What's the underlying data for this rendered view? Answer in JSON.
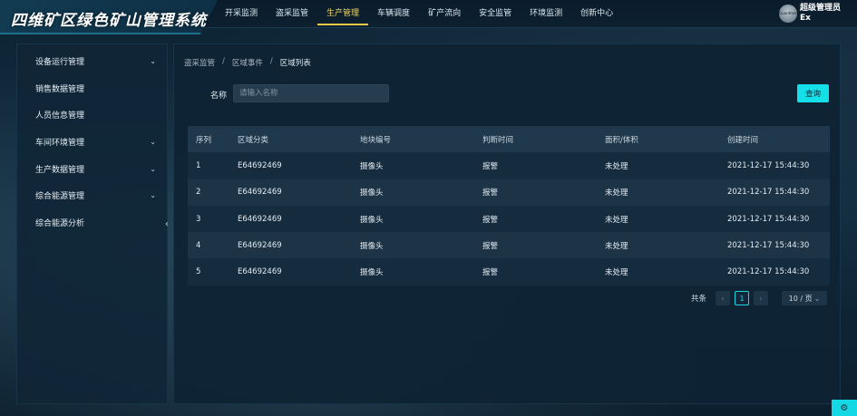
{
  "app": {
    "title": "四维矿区绿色矿山管理系统"
  },
  "topnav": {
    "items": [
      {
        "label": "开采监测"
      },
      {
        "label": "盗采监管"
      },
      {
        "label": "生产管理"
      },
      {
        "label": "车辆调度"
      },
      {
        "label": "矿产流向"
      },
      {
        "label": "安全监管"
      },
      {
        "label": "环境监测"
      },
      {
        "label": "创新中心"
      }
    ],
    "active_index": 2
  },
  "user": {
    "name": "超级管理员",
    "sub": "Ex",
    "avatar_text": "Guardmen"
  },
  "sidebar": {
    "items": [
      {
        "label": "设备运行管理",
        "chevron": "chevron-down-icon"
      },
      {
        "label": "销售数据管理"
      },
      {
        "label": "人员信息管理"
      },
      {
        "label": "车间环境管理",
        "chevron": "chevron-down-icon"
      },
      {
        "label": "生产数据管理",
        "chevron": "chevron-down-icon"
      },
      {
        "label": "综合能源管理",
        "chevron": "chevron-down-icon"
      },
      {
        "label": "综合能源分析"
      }
    ]
  },
  "breadcrumb": {
    "items": [
      "盗采监管",
      "区域事件",
      "区域列表"
    ],
    "separator": "/"
  },
  "filter": {
    "label": "名称",
    "placeholder": "请输入名称",
    "value": "",
    "button": "查询"
  },
  "table": {
    "headers": [
      "序列",
      "区域分类",
      "地块编号",
      "判断时间",
      "面积/体积",
      "创建时间"
    ],
    "rows": [
      [
        "1",
        "E64692469",
        "摄像头",
        "报警",
        "未处理",
        "2021-12-17 15:44:30"
      ],
      [
        "2",
        "E64692469",
        "摄像头",
        "报警",
        "未处理",
        "2021-12-17 15:44:30"
      ],
      [
        "3",
        "E64692469",
        "摄像头",
        "报警",
        "未处理",
        "2021-12-17 15:44:30"
      ],
      [
        "4",
        "E64692469",
        "摄像头",
        "报警",
        "未处理",
        "2021-12-17 15:44:30"
      ],
      [
        "5",
        "E64692469",
        "摄像头",
        "报警",
        "未处理",
        "2021-12-17 15:44:30"
      ]
    ]
  },
  "pagination": {
    "total_label": "共条",
    "current_page": "1",
    "page_size": "10 / 页"
  },
  "colors": {
    "accent": "#14e0ea",
    "active_nav": "#e9c84b",
    "background": "#0d2233"
  }
}
